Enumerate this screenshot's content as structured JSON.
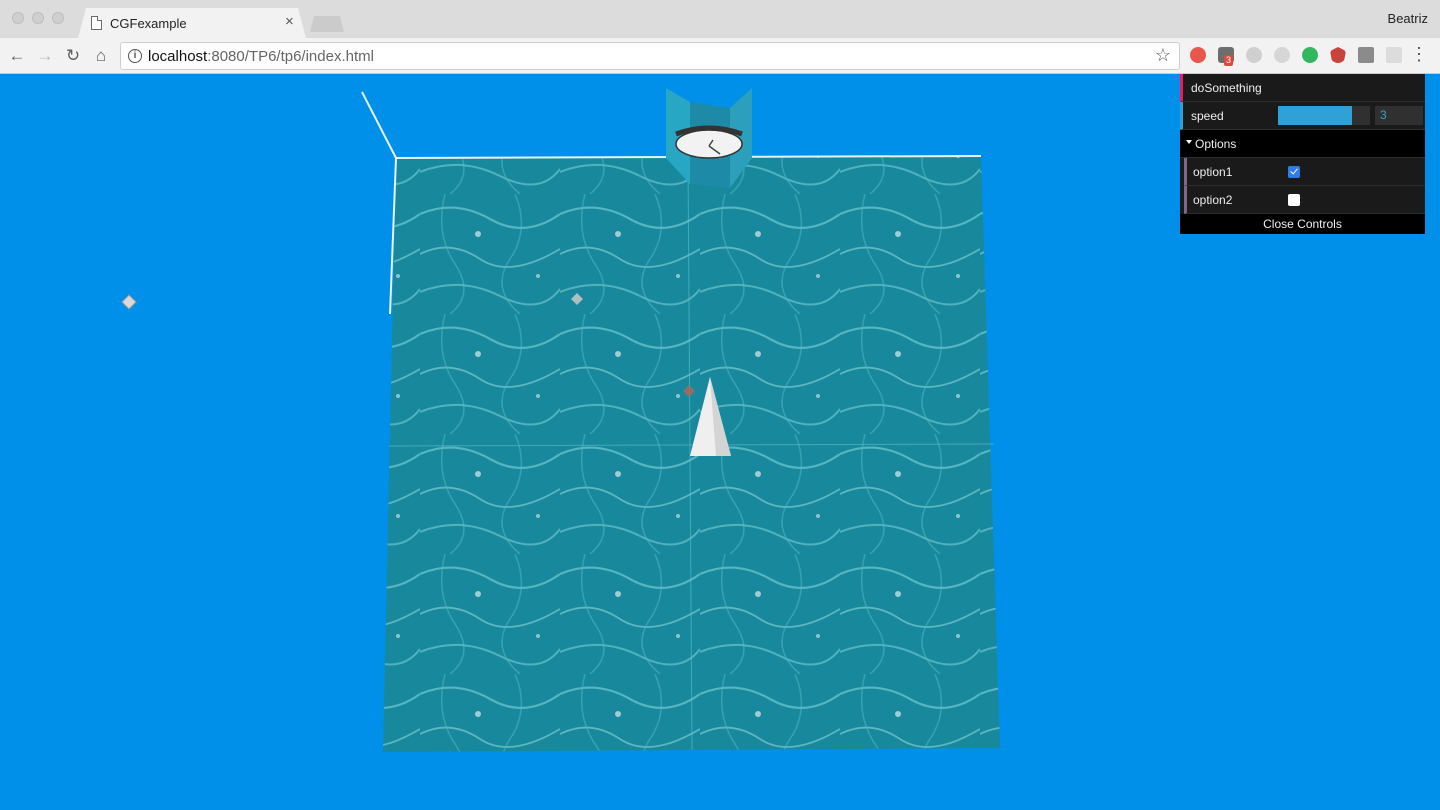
{
  "browser": {
    "tab_title": "CGFexample",
    "tab_close": "×",
    "profile_name": "Beatriz",
    "url_host": "localhost",
    "url_rest": ":8080/TP6/tp6/index.html",
    "info_glyph": "i",
    "back_glyph": "←",
    "forward_glyph": "→",
    "reload_glyph": "↻",
    "home_glyph": "⌂",
    "star_glyph": "☆",
    "menu_glyph": "⋮",
    "extension_badge": "3"
  },
  "scene": {
    "background_color": "#0090ea",
    "water_color": "#1b8fa3"
  },
  "gui": {
    "do_something_label": "doSomething",
    "speed_label": "speed",
    "speed_value": "3",
    "speed_fraction": 0.8,
    "folder_label": "Options",
    "option1_label": "option1",
    "option1_checked": true,
    "option2_label": "option2",
    "option2_checked": false,
    "close_label": "Close Controls"
  }
}
